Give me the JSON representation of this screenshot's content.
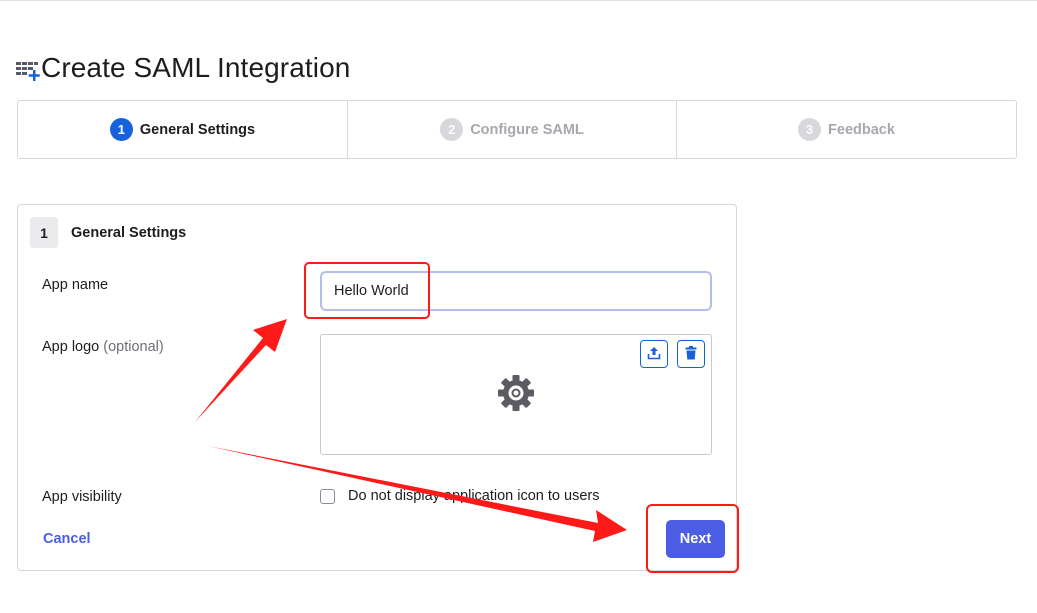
{
  "page": {
    "title": "Create SAML Integration",
    "title_icon": "app-grid-plus-icon"
  },
  "stepper": {
    "steps": [
      {
        "number": "1",
        "label": "General Settings",
        "state": "active"
      },
      {
        "number": "2",
        "label": "Configure SAML",
        "state": "inactive"
      },
      {
        "number": "3",
        "label": "Feedback",
        "state": "inactive"
      }
    ]
  },
  "section": {
    "number": "1",
    "title": "General Settings"
  },
  "form": {
    "app_name_label": "App name",
    "app_name_value": "Hello World",
    "app_logo_label": "App logo",
    "app_logo_optional": "(optional)",
    "upload_icon": "upload-icon",
    "delete_icon": "trash-icon",
    "placeholder_logo_icon": "gear-icon",
    "visibility_label": "App visibility",
    "visibility_checkbox_label": "Do not display application icon to users",
    "visibility_checked": false
  },
  "actions": {
    "cancel_label": "Cancel",
    "next_label": "Next"
  },
  "colors": {
    "accent": "#4a5de3",
    "active_step": "#1662dd",
    "annotation": "#ff1a1a"
  }
}
